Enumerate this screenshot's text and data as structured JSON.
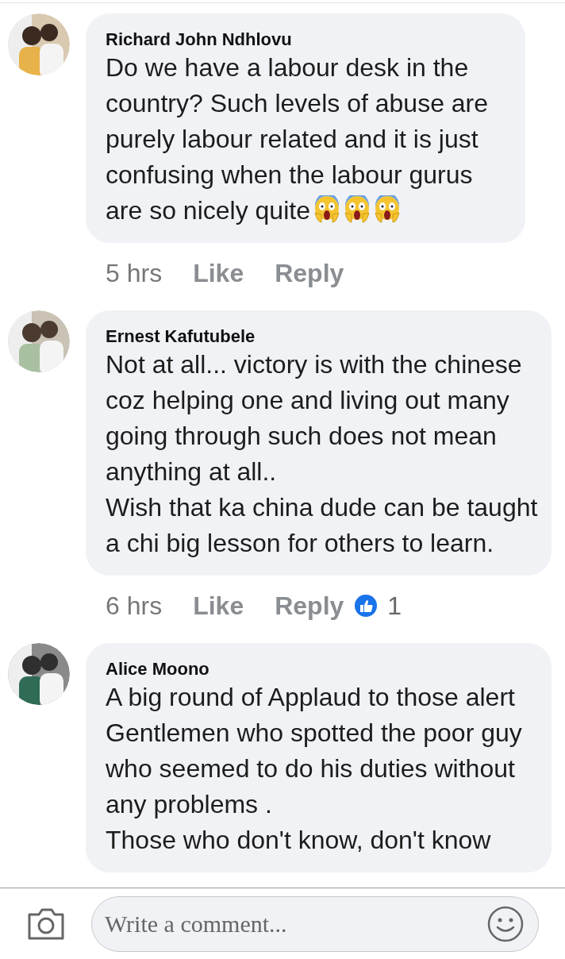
{
  "comments": [
    {
      "author": "Richard John Ndhlovu",
      "text": "Do we have a labour desk in the country? Such levels of abuse are purely labour related and it is just confusing when the labour gurus are so nicely quite",
      "emojis": [
        {
          "kind": "scream"
        },
        {
          "kind": "scream"
        },
        {
          "kind": "scream"
        }
      ],
      "time": "5 hrs",
      "actions": [
        "Like",
        "Reply"
      ]
    },
    {
      "author": "Ernest Kafutubele",
      "text": "Not at all... victory is with the chinese coz helping one and living out many going through such does not mean anything at all..\nWish that ka china dude can be taught a chi big lesson for others to learn.",
      "time": "6 hrs",
      "actions": [
        "Like",
        "Reply"
      ],
      "likes": "1"
    },
    {
      "author": "Alice Moono",
      "text": "A big round of Applaud to those alert Gentlemen who spotted the poor guy who seemed to do his duties without any problems .\nThose who don't know, don't know"
    }
  ],
  "composer": {
    "placeholder": "Write a comment..."
  }
}
